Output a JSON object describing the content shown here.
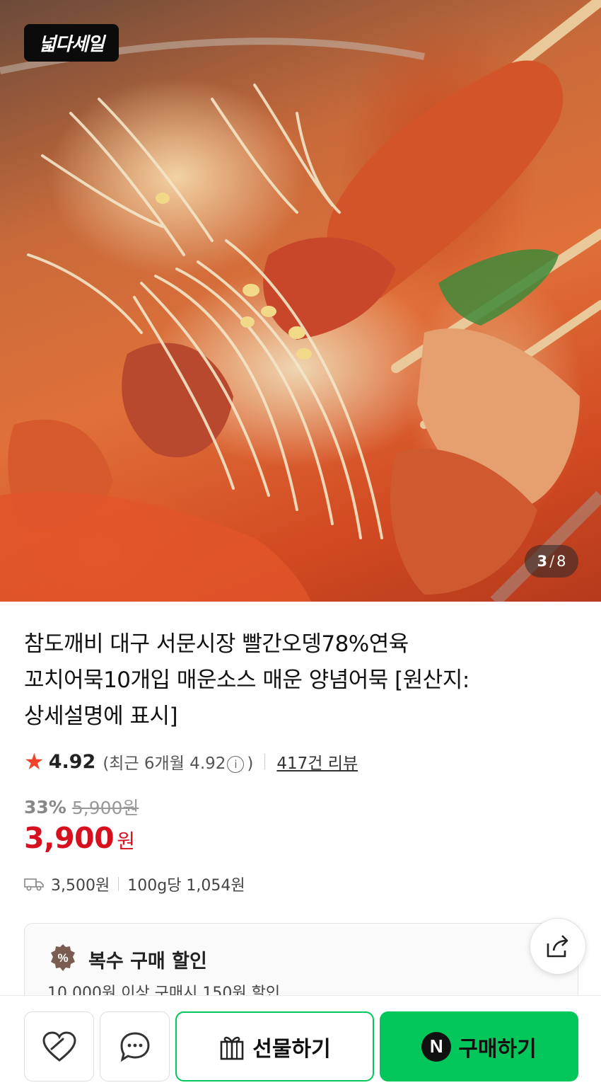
{
  "hero": {
    "logo_text": "넓다세일",
    "image_index": "3",
    "image_total": "8"
  },
  "product": {
    "title_lines": [
      "참도깨비 대구 서문시장 빨간오뎅78%연육",
      "꼬치어묵10개입 매운소스 매운 양념어묵 [원산지:",
      "상세설명에 표시]"
    ]
  },
  "rating": {
    "score": "4.92",
    "recent_prefix": "(최근 6개월 4.92",
    "recent_suffix": ")",
    "info_icon": "ⓘ",
    "review_link": "417건 리뷰"
  },
  "price": {
    "discount_rate": "33%",
    "original_price": "5,900원",
    "sale_price": "3,900",
    "currency": "원"
  },
  "shipping": {
    "fee": "3,500원",
    "unit_price": "100g당 1,054원"
  },
  "promo": {
    "title": "복수 구매 할인",
    "subtitle": "10,000원 이상 구매시 150원 할인",
    "badge_symbol": "%"
  },
  "actions": {
    "gift_label": "선물하기",
    "buy_label": "구매하기",
    "n_logo": "N"
  },
  "icons": {
    "wishlist": "heart-icon",
    "chat": "chat-bubble-icon",
    "share": "share-icon",
    "gift": "gift-icon",
    "truck": "truck-icon",
    "star": "star-icon"
  },
  "colors": {
    "accent_green": "#03c75a",
    "price_red": "#d6101e",
    "star_red": "#f0442c"
  }
}
